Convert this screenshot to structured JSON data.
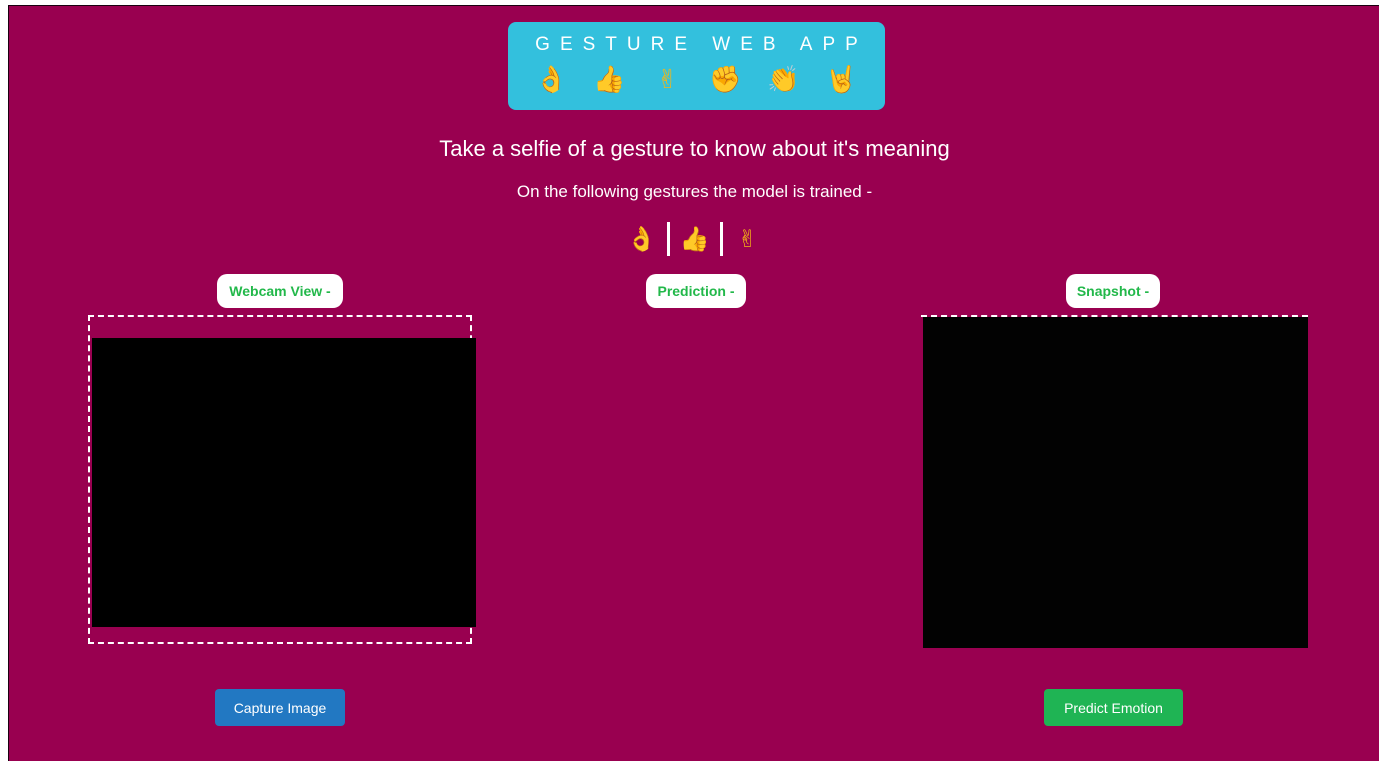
{
  "app": {
    "banner_title": "GESTURE WEB APP",
    "banner_emojis": [
      {
        "icon": "ok-hand-icon",
        "glyph": "👌"
      },
      {
        "icon": "thumbs-up-icon",
        "glyph": "👍"
      },
      {
        "icon": "victory-hand-icon",
        "glyph": "✌"
      },
      {
        "icon": "raised-fist-icon",
        "glyph": "✊"
      },
      {
        "icon": "clapping-hands-icon",
        "glyph": "👏"
      },
      {
        "icon": "sign-of-horns-icon",
        "glyph": "🤘"
      }
    ]
  },
  "main": {
    "heading": "Take a selfie of a gesture to know about it's meaning",
    "subheading": "On the following gestures the model is trained -",
    "trained_gestures": [
      {
        "icon": "ok-hand-icon",
        "glyph": "👌"
      },
      {
        "icon": "thumbs-up-icon",
        "glyph": "👍"
      },
      {
        "icon": "victory-hand-icon",
        "glyph": "✌"
      }
    ]
  },
  "panels": {
    "webcam_label": "Webcam View -",
    "prediction_label": "Prediction -",
    "snapshot_label": "Snapshot -"
  },
  "actions": {
    "capture_label": "Capture Image",
    "predict_label": "Predict Emotion"
  },
  "colors": {
    "background": "#990050",
    "banner": "#33c0dd",
    "label_text": "#22b84a",
    "capture_button": "#2278c2",
    "predict_button": "#1fb454"
  }
}
